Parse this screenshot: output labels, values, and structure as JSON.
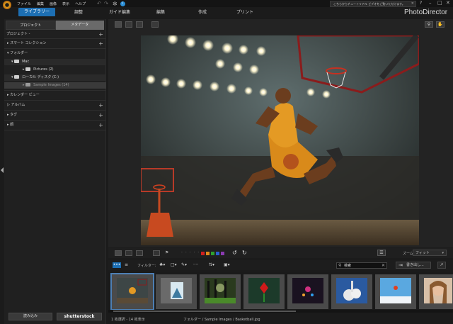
{
  "app": {
    "name": "PhotoDirector",
    "menu": [
      "ファイル",
      "編集",
      "画像",
      "表示",
      "ヘルプ"
    ],
    "tutorial_banner": "こちらからチュートリアル ビデオをご覧いただけます。"
  },
  "modes": [
    {
      "label": "ライブラリー",
      "active": true
    },
    {
      "label": "調整",
      "active": false
    },
    {
      "label": "ガイド編集",
      "active": false
    },
    {
      "label": "編集",
      "active": false
    },
    {
      "label": "作成",
      "active": false
    },
    {
      "label": "プリント",
      "active": false
    }
  ],
  "left_panel": {
    "tabs": [
      "プロジェクト",
      "メタデータ"
    ],
    "project_header": "プロジェクト -",
    "smart_collection": "スマート コレクション",
    "folder": "フォルダー",
    "mac": "Mac",
    "pictures": "Pictures (2)",
    "local_disk": "ローカル ディスク (C:)",
    "sample_images": "Sample Images (14)",
    "calendar": "カレンダー ビュー",
    "album": "アルバム",
    "tags": "タグ",
    "faces": "顔",
    "import_button": "読み込み",
    "shutterstock_button": "shutterstock"
  },
  "edit_bar": {
    "zoom_label": "ズーム:",
    "zoom_value": "フィット",
    "color_labels": [
      "#d02020",
      "#e08a1a",
      "#2ea02e",
      "#2a5cd0",
      "#8a3ab0"
    ]
  },
  "filter_bar": {
    "label": "フィルター:",
    "search_value": "検索",
    "export_label": "書き出し..."
  },
  "filmstrip": {
    "count": 8,
    "selected_index": 0
  },
  "status": {
    "selection": "1 枚選択 - 14 枚表示",
    "path": "フォルダー / Sample Images / Basketball.jpg"
  }
}
